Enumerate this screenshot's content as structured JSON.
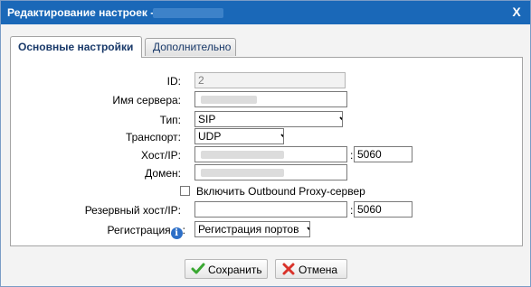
{
  "dialog": {
    "title": "Редактирование настроек -",
    "close_label": "X"
  },
  "tabs": [
    {
      "label": "Основные настройки",
      "active": true
    },
    {
      "label": "Дополнительно",
      "active": false
    }
  ],
  "form": {
    "id_label": "ID:",
    "id_value": "2",
    "server_name_label": "Имя сервера:",
    "type_label": "Тип:",
    "type_value": "SIP",
    "transport_label": "Транспорт:",
    "transport_value": "UDP",
    "host_label": "Хост/IP:",
    "host_port": "5060",
    "domain_label": "Домен:",
    "outbound_proxy_label": "Включить Outbound Proxy-сервер",
    "outbound_proxy_checked": false,
    "backup_host_label": "Резервный хост/IP:",
    "backup_host_value": "",
    "backup_port": "5060",
    "registration_label": "Регистрация",
    "registration_colon": ":",
    "registration_value": "Регистрация портов",
    "colon": ":"
  },
  "buttons": {
    "save_label": "Сохранить",
    "cancel_label": "Отмена"
  },
  "colors": {
    "titlebar": "#1a68b8",
    "save_icon": "#3aa832",
    "cancel_icon": "#d9322a"
  }
}
